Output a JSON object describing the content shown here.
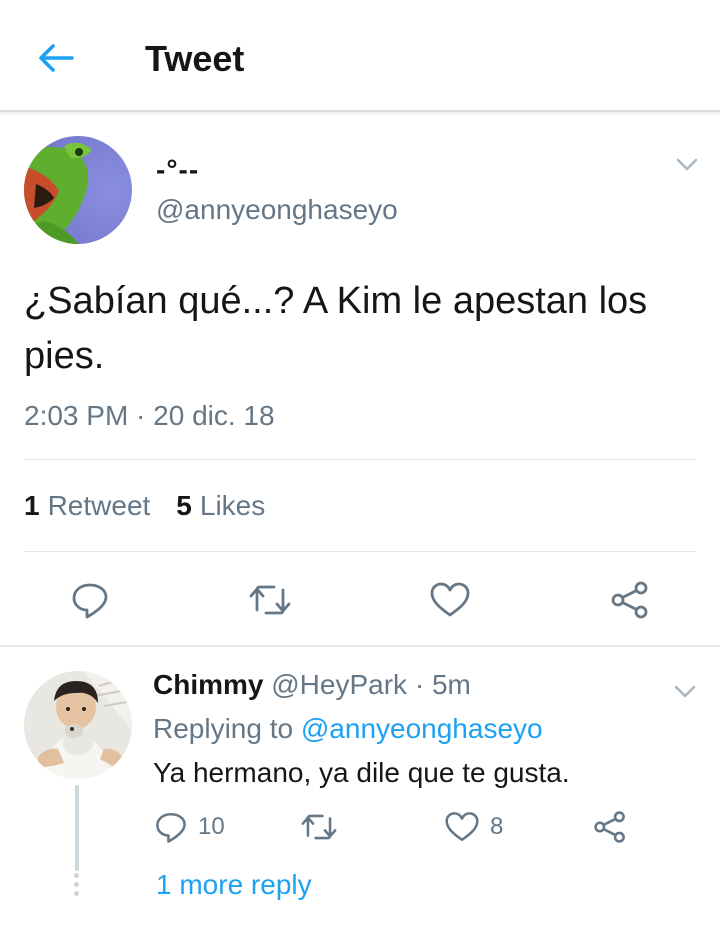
{
  "header": {
    "title": "Tweet",
    "back_icon": "back-arrow-icon"
  },
  "colors": {
    "accent": "#1da1f2",
    "secondary_text": "#657786",
    "primary_text": "#14171a",
    "divider": "#e1e8ed"
  },
  "tweet": {
    "display_name": "-°--",
    "handle": "@annyeonghaseyo",
    "text": "¿Sabían qué...? A Kim le apestan los pies.",
    "timestamp": "2:03 PM · 20 dic. 18",
    "stats": {
      "retweets_count": "1",
      "retweets_label": "Retweet",
      "likes_count": "5",
      "likes_label": "Likes"
    },
    "actions": [
      "reply-icon",
      "retweet-icon",
      "like-icon",
      "share-icon"
    ]
  },
  "reply": {
    "display_name": "Chimmy",
    "handle": "@HeyPark",
    "time": "5m",
    "meta_separator": " · ",
    "replying_prefix": "Replying to",
    "replying_to": "@annyeonghaseyo",
    "text": "Ya hermano, ya dile que te gusta.",
    "reply_count": "10",
    "like_count": "8",
    "more_replies": "1 more reply"
  }
}
